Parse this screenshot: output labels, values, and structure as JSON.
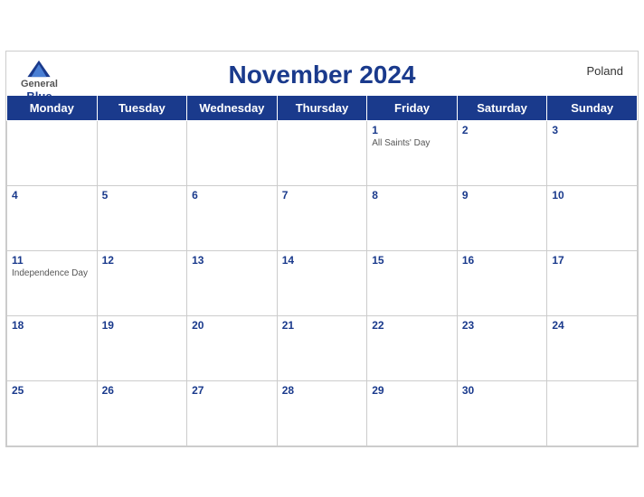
{
  "header": {
    "title": "November 2024",
    "country": "Poland",
    "logo": {
      "general": "General",
      "blue": "Blue"
    }
  },
  "days_of_week": [
    "Monday",
    "Tuesday",
    "Wednesday",
    "Thursday",
    "Friday",
    "Saturday",
    "Sunday"
  ],
  "weeks": [
    [
      {
        "day": "",
        "event": ""
      },
      {
        "day": "",
        "event": ""
      },
      {
        "day": "",
        "event": ""
      },
      {
        "day": "",
        "event": ""
      },
      {
        "day": "1",
        "event": "All Saints' Day"
      },
      {
        "day": "2",
        "event": ""
      },
      {
        "day": "3",
        "event": ""
      }
    ],
    [
      {
        "day": "4",
        "event": ""
      },
      {
        "day": "5",
        "event": ""
      },
      {
        "day": "6",
        "event": ""
      },
      {
        "day": "7",
        "event": ""
      },
      {
        "day": "8",
        "event": ""
      },
      {
        "day": "9",
        "event": ""
      },
      {
        "day": "10",
        "event": ""
      }
    ],
    [
      {
        "day": "11",
        "event": "Independence Day"
      },
      {
        "day": "12",
        "event": ""
      },
      {
        "day": "13",
        "event": ""
      },
      {
        "day": "14",
        "event": ""
      },
      {
        "day": "15",
        "event": ""
      },
      {
        "day": "16",
        "event": ""
      },
      {
        "day": "17",
        "event": ""
      }
    ],
    [
      {
        "day": "18",
        "event": ""
      },
      {
        "day": "19",
        "event": ""
      },
      {
        "day": "20",
        "event": ""
      },
      {
        "day": "21",
        "event": ""
      },
      {
        "day": "22",
        "event": ""
      },
      {
        "day": "23",
        "event": ""
      },
      {
        "day": "24",
        "event": ""
      }
    ],
    [
      {
        "day": "25",
        "event": ""
      },
      {
        "day": "26",
        "event": ""
      },
      {
        "day": "27",
        "event": ""
      },
      {
        "day": "28",
        "event": ""
      },
      {
        "day": "29",
        "event": ""
      },
      {
        "day": "30",
        "event": ""
      },
      {
        "day": "",
        "event": ""
      }
    ]
  ]
}
